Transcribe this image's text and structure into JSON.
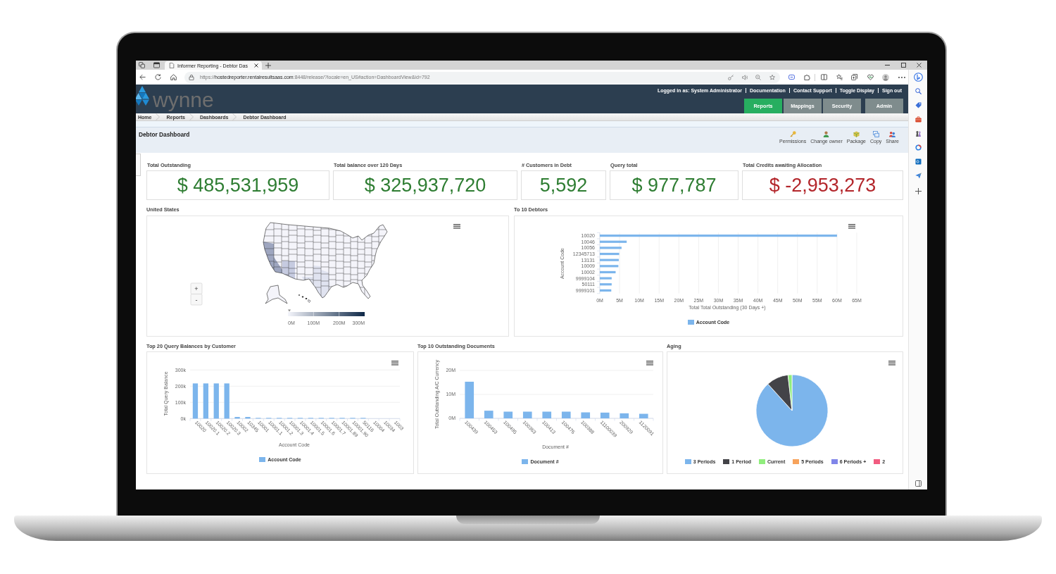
{
  "browser": {
    "tab_title": "Informer Reporting - Debtor Das",
    "url": [
      "https://",
      "hostedreporter.rentalresultsaas.com",
      ":8448/release/?locale=en_US#action=DashboardView&id=792"
    ]
  },
  "header": {
    "logo_text": "wynne",
    "logged_in_as": "Logged in as: System Administrator",
    "links": [
      "Documentation",
      "Contact Support",
      "Toggle Display",
      "Sign out"
    ],
    "nav": [
      {
        "label": "Reports",
        "selected": true
      },
      {
        "label": "Mappings",
        "selected": false
      },
      {
        "label": "Security",
        "selected": false
      },
      {
        "label": "Admin",
        "selected": false
      }
    ]
  },
  "breadcrumbs": [
    "Home",
    "Reports",
    "Dashboards",
    "Debtor Dashboard"
  ],
  "page": {
    "title": "Debtor Dashboard",
    "actions": [
      {
        "label": "Permissions",
        "kind": "permissions"
      },
      {
        "label": "Change owner",
        "kind": "owner"
      },
      {
        "label": "Package",
        "kind": "package"
      },
      {
        "label": "Copy",
        "kind": "copy"
      },
      {
        "label": "Share",
        "kind": "share"
      }
    ]
  },
  "kpis": [
    {
      "label": "Total Outstanding",
      "value": "$ 485,531,959",
      "negative": false
    },
    {
      "label": "Total balance over 120 Days",
      "value": "$ 325,937,720",
      "negative": false
    },
    {
      "label": "# Customers in Debt",
      "value": "5,592",
      "negative": false
    },
    {
      "label": "Query total",
      "value": "$ 977,787",
      "negative": false
    },
    {
      "label": "Total Credits awaiting Allocation",
      "value": "$ -2,953,273",
      "negative": true
    }
  ],
  "map_panel": {
    "title": "United States",
    "zoom_buttons": [
      "+",
      "-"
    ],
    "scale_labels": [
      "0M",
      "100M",
      "200M",
      "300M"
    ]
  },
  "debtors_panel": {
    "title": "To 10 Debtors",
    "chart_data": {
      "type": "bar",
      "orientation": "horizontal",
      "xlabel": "Total Total Outstanding (30 Days +)",
      "ylabel": "Account Code",
      "categories": [
        "10020",
        "10046",
        "10056",
        "12345713",
        "13131",
        "10009",
        "10002",
        "9999104",
        "50111",
        "9999101"
      ],
      "series": [
        {
          "name": "Account Code",
          "color": "#7cb5ec",
          "values": [
            60000000,
            6800000,
            5500000,
            4900000,
            4800000,
            4700000,
            4000000,
            3000000,
            3000000,
            2900000
          ]
        }
      ],
      "xlim": [
        0,
        65000000
      ],
      "xticks": [
        {
          "value": 0,
          "label": "0M"
        },
        {
          "value": 5000000,
          "label": "5M"
        },
        {
          "value": 10000000,
          "label": "10M"
        },
        {
          "value": 15000000,
          "label": "15M"
        },
        {
          "value": 20000000,
          "label": "20M"
        },
        {
          "value": 25000000,
          "label": "25M"
        },
        {
          "value": 30000000,
          "label": "30M"
        },
        {
          "value": 35000000,
          "label": "35M"
        },
        {
          "value": 40000000,
          "label": "40M"
        },
        {
          "value": 45000000,
          "label": "45M"
        },
        {
          "value": 50000000,
          "label": "50M"
        },
        {
          "value": 55000000,
          "label": "55M"
        },
        {
          "value": 60000000,
          "label": "60M"
        },
        {
          "value": 65000000,
          "label": "65M"
        }
      ],
      "grid": true,
      "legend": "bottom"
    }
  },
  "query_panel": {
    "title": "Top 20 Query Balances by Customer",
    "chart_data": {
      "type": "bar",
      "xlabel": "Account Code",
      "ylabel": "Total Query Balance",
      "categories": [
        "10020",
        "10020.1",
        "10020.2",
        "10020.3",
        "10002",
        "10345",
        "10001",
        "10001.1",
        "10001.2",
        "10001.3",
        "10001.4",
        "10001.5",
        "10001.6",
        "10001.7",
        "10001.89",
        "10001.90",
        "50116",
        "10004",
        "10034",
        "1003"
      ],
      "series": [
        {
          "name": "Account Code",
          "color": "#7cb5ec",
          "values": [
            217000,
            217000,
            217000,
            217000,
            10000,
            10000,
            4000,
            4000,
            4000,
            4000,
            4000,
            4000,
            4000,
            4000,
            4000,
            4000,
            4000,
            0,
            0,
            0
          ]
        }
      ],
      "ylim": [
        0,
        300000
      ],
      "yticks": [
        {
          "value": 0,
          "label": "0k"
        },
        {
          "value": 100000,
          "label": "100k"
        },
        {
          "value": 200000,
          "label": "200k"
        },
        {
          "value": 300000,
          "label": "300k"
        }
      ],
      "grid": true,
      "legend": "bottom"
    }
  },
  "documents_panel": {
    "title": "Top 10 Outstanding Documents",
    "chart_data": {
      "type": "bar",
      "xlabel": "Document #",
      "ylabel": "Total Outstanding A/C Currency",
      "categories": [
        "100439",
        "100453",
        "100495",
        "100363",
        "100413",
        "100476",
        "100388",
        "11100039",
        "200929",
        "1120091"
      ],
      "series": [
        {
          "name": "Document #",
          "color": "#7cb5ec",
          "values": [
            15300000,
            3200000,
            2800000,
            2800000,
            2800000,
            2800000,
            2500000,
            2400000,
            2100000,
            1900000
          ]
        }
      ],
      "ylim": [
        0,
        20000000
      ],
      "yticks": [
        {
          "value": 0,
          "label": "0M"
        },
        {
          "value": 10000000,
          "label": "10M"
        },
        {
          "value": 20000000,
          "label": "20M"
        }
      ],
      "grid": true,
      "legend": "bottom"
    }
  },
  "aging_panel": {
    "title": "Aging",
    "chart_data": {
      "type": "pie",
      "categories": [
        "3 Periods",
        "1 Period",
        "Current",
        "5 Periods",
        "6 Periods +",
        "2"
      ],
      "values": [
        88.3,
        9.9,
        1.8,
        0,
        0,
        0
      ],
      "colors": [
        "#7cb5ec",
        "#434348",
        "#90ed7d",
        "#f7a35c",
        "#8085e9",
        "#f15c80"
      ],
      "legend": "bottom"
    }
  }
}
